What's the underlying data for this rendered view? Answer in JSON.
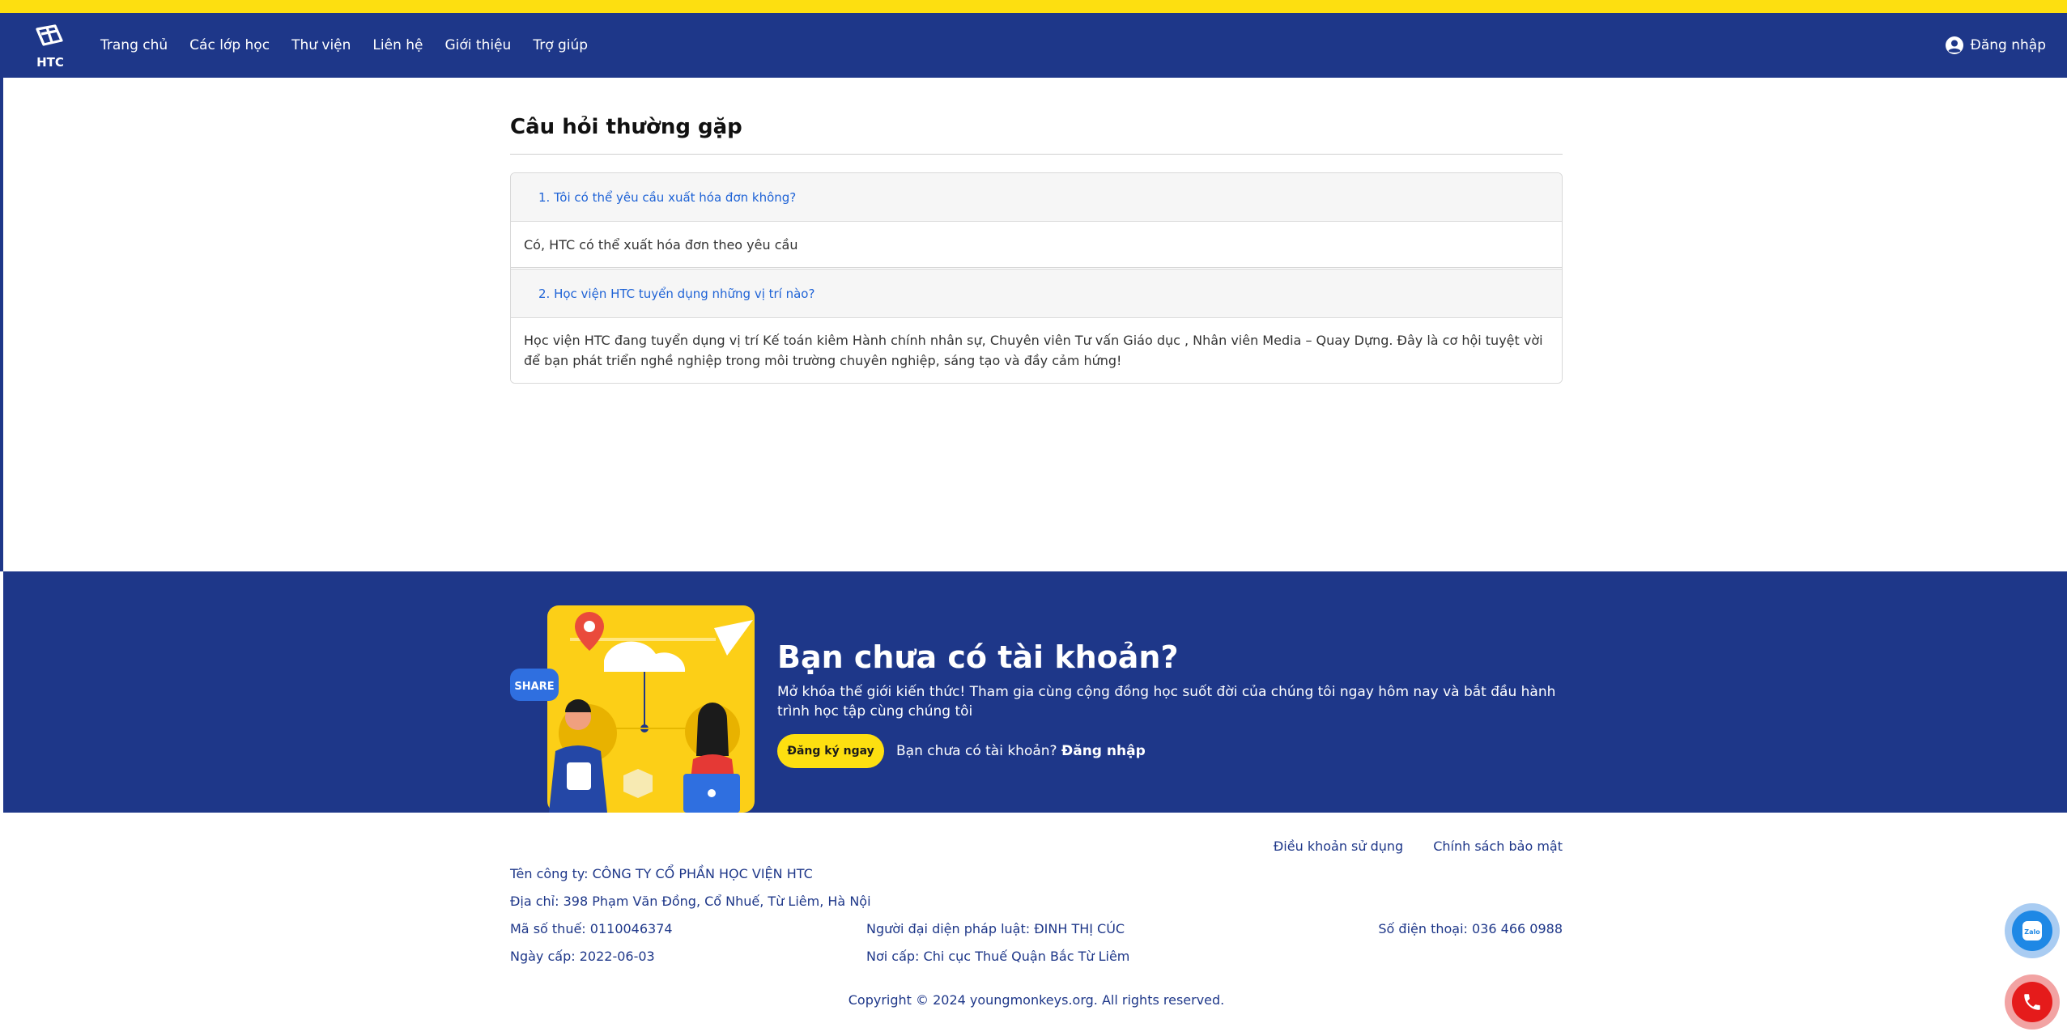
{
  "nav": {
    "logo_text": "HTC",
    "items": [
      "Trang chủ",
      "Các lớp học",
      "Thư viện",
      "Liên hệ",
      "Giới thiệu",
      "Trợ giúp"
    ],
    "login_label": "Đăng nhập"
  },
  "faq": {
    "title": "Câu hỏi thường gặp",
    "items": [
      {
        "question": "1. Tôi có thể yêu cầu xuất hóa đơn không?",
        "answer": "Có, HTC có thể xuất hóa đơn theo yêu cầu"
      },
      {
        "question": "2. Học viện HTC tuyển dụng những vị trí nào?",
        "answer": "Học viện HTC đang tuyển dụng vị trí Kế toán kiêm Hành chính nhân sự, Chuyên viên Tư vấn Giáo dục , Nhân viên Media – Quay Dựng. Đây là cơ hội tuyệt vời để bạn phát triển nghề nghiệp trong môi trường chuyên nghiệp, sáng tạo và đầy cảm hứng!"
      }
    ]
  },
  "cta": {
    "share_label": "SHARE",
    "title": "Bạn chưa có tài khoản?",
    "description": "Mở khóa thế giới kiến thức! Tham gia cùng cộng đồng học suốt đời của chúng tôi ngay hôm nay và bắt đầu hành trình học tập cùng chúng tôi",
    "register_button": "Đăng ký ngay",
    "login_prompt": "Bạn chưa có tài khoản?",
    "login_link": "Đăng nhập"
  },
  "footer": {
    "terms": "Điều khoản sử dụng",
    "privacy": "Chính sách bảo mật",
    "company": "Tên công ty: CÔNG TY CỔ PHẦN HỌC VIỆN HTC",
    "address": "Địa chỉ: 398 Phạm Văn Đồng, Cổ Nhuế, Từ Liêm, Hà Nội",
    "tax_code": "Mã số thuế: 0110046374",
    "legal_rep": "Người đại diện pháp luật: ĐINH THỊ CÚC",
    "phone": "Số điện thoại: 036 466 0988",
    "issue_date": "Ngày cấp: 2022-06-03",
    "issue_place": "Nơi cấp: Chi cục Thuế Quận Bắc Từ Liêm",
    "copyright": "Copyright © 2024 youngmonkeys.org. All rights reserved."
  },
  "floating": {
    "zalo_label": "Zalo"
  },
  "colors": {
    "primary": "#1e3789",
    "accent": "#fddf10",
    "link": "#1f63d6"
  }
}
